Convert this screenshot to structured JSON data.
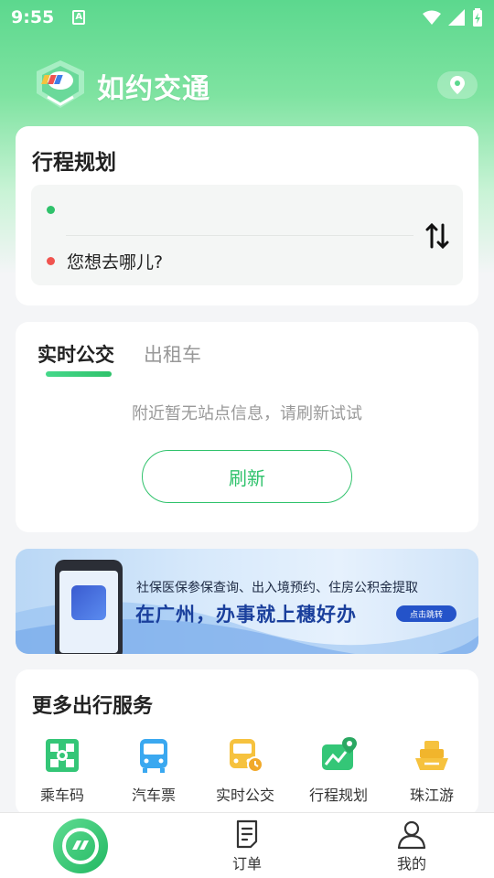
{
  "status_bar": {
    "time": "9:55",
    "notification_letter": "A"
  },
  "app": {
    "title": "如约交通"
  },
  "trip_planner": {
    "title": "行程规划",
    "origin_value": "",
    "destination_placeholder": "您想去哪儿?"
  },
  "realtime": {
    "tabs": [
      "实时公交",
      "出租车"
    ],
    "active_tab": "实时公交",
    "empty_message": "附近暂无站点信息，请刷新试试",
    "refresh_label": "刷新"
  },
  "banner": {
    "line1": "社保医保参保查询、出入境预约、住房公积金提取",
    "line2": "在广州，办事就上穗好办",
    "cta": "点击跳转"
  },
  "services": {
    "title": "更多出行服务",
    "items": [
      {
        "label": "乘车码",
        "icon": "qr-code-icon"
      },
      {
        "label": "汽车票",
        "icon": "bus-ticket-icon"
      },
      {
        "label": "实时公交",
        "icon": "realtime-bus-icon"
      },
      {
        "label": "行程规划",
        "icon": "route-map-icon"
      },
      {
        "label": "珠江游",
        "icon": "cruise-ship-icon"
      }
    ]
  },
  "bottom_nav": {
    "items": [
      {
        "label": "",
        "icon": "home-logo-icon"
      },
      {
        "label": "订单",
        "icon": "order-icon"
      },
      {
        "label": "我的",
        "icon": "profile-icon"
      }
    ]
  },
  "colors": {
    "brand_green": "#2fc26b",
    "destination_dot": "#f0544f",
    "banner_blue": "#1a3f9c"
  }
}
